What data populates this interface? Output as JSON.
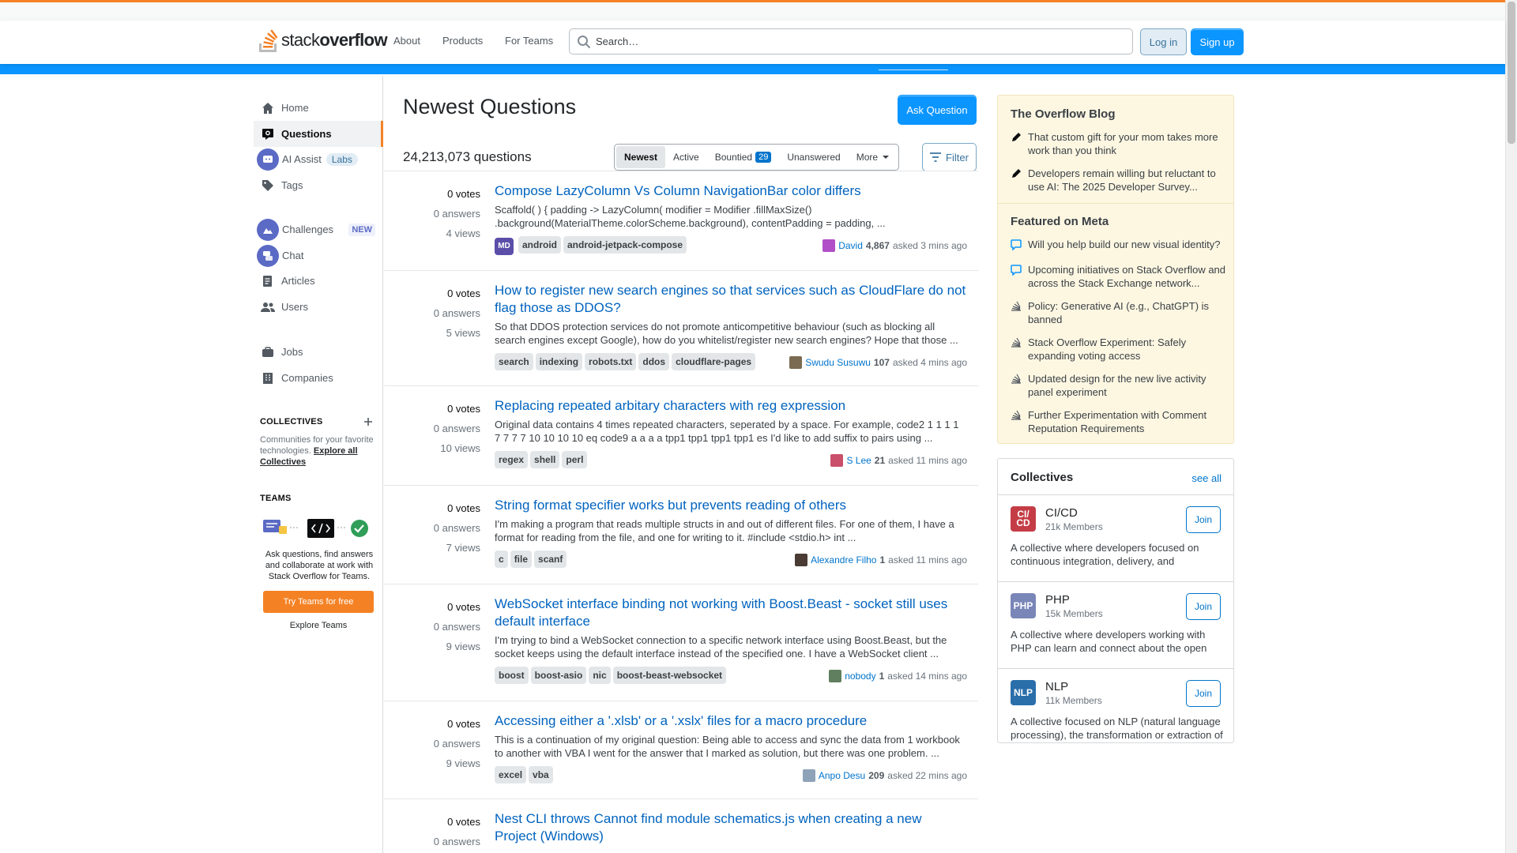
{
  "header": {
    "logo_text_light": "stack",
    "logo_text_bold": "overflow",
    "nav": [
      "About",
      "Products",
      "For Teams"
    ],
    "search_placeholder": "Search…",
    "login_label": "Log in",
    "signup_label": "Sign up"
  },
  "sidebar": {
    "items": [
      {
        "label": "Home",
        "icon": "home-icon"
      },
      {
        "label": "Questions",
        "icon": "questions-icon"
      },
      {
        "label": "AI Assist",
        "icon": "ai-assist-icon",
        "badge": "Labs"
      },
      {
        "label": "Tags",
        "icon": "tag-icon"
      },
      {
        "label": "Challenges",
        "icon": "challenges-icon",
        "badge": "NEW"
      },
      {
        "label": "Chat",
        "icon": "chat-icon"
      },
      {
        "label": "Articles",
        "icon": "articles-icon"
      },
      {
        "label": "Users",
        "icon": "users-icon"
      },
      {
        "label": "Jobs",
        "icon": "jobs-icon"
      },
      {
        "label": "Companies",
        "icon": "companies-icon"
      }
    ],
    "collectives_heading": "COLLECTIVES",
    "collectives_text": "Communities for your favorite technologies.",
    "collectives_link": "Explore all Collectives",
    "teams_heading": "TEAMS",
    "teams_text": "Ask questions, find answers and collaborate at work with Stack Overflow for Teams.",
    "teams_button": "Try Teams for free",
    "teams_explore": "Explore Teams"
  },
  "main": {
    "title": "Newest Questions",
    "ask_button": "Ask Question",
    "question_count": "24,213,073 questions",
    "filters": [
      {
        "label": "Newest",
        "active": true
      },
      {
        "label": "Active"
      },
      {
        "label": "Bountied",
        "count": "29"
      },
      {
        "label": "Unanswered"
      },
      {
        "label": "More"
      }
    ],
    "filter_button": "Filter",
    "questions": [
      {
        "votes": "0 votes",
        "answers": "0 answers",
        "views": "4 views",
        "title": "Compose LazyColumn Vs Column NavigationBar color differs",
        "excerpt": "Scaffold( ) { padding -> LazyColumn( modifier = Modifier .fillMaxSize() .background(MaterialTheme.colorScheme.background), contentPadding = padding, ...",
        "collective_tag": "MD",
        "tags": [
          "android",
          "android-jetpack-compose"
        ],
        "user": "David",
        "rep": "4,867",
        "asked": "asked 3 mins ago",
        "avatar_color": "#b04fc7"
      },
      {
        "votes": "0 votes",
        "answers": "0 answers",
        "views": "5 views",
        "title": "How to register new search engines so that services such as CloudFlare do not flag those as DDOS?",
        "excerpt": "So that DDOS protection services do not promote anticompetitive behaviour (such as blocking all search engines except Google), how do you whitelist/register new search engines? Hope that those ...",
        "tags": [
          "search",
          "indexing",
          "robots.txt",
          "ddos",
          "cloudflare-pages"
        ],
        "user": "Swudu Susuwu",
        "rep": "107",
        "asked": "asked 4 mins ago",
        "avatar_color": "#7a6b52"
      },
      {
        "votes": "0 votes",
        "answers": "0 answers",
        "views": "10 views",
        "title": "Replacing repeated arbitary characters with reg expression",
        "excerpt": "Original data contains 4 times repeated characters, seperated by a space. For example, code2 1 1 1 1 7 7 7 7 10 10 10 10 eq code9 a a a a tpp1 tpp1 tpp1 tpp1 es I'd like to add suffix to pairs using ...",
        "tags": [
          "regex",
          "shell",
          "perl"
        ],
        "user": "S Lee",
        "rep": "21",
        "asked": "asked 11 mins ago",
        "avatar_color": "#c94f6a"
      },
      {
        "votes": "0 votes",
        "answers": "0 answers",
        "views": "7 views",
        "title": "String format specifier works but prevents reading of others",
        "excerpt": "I'm making a program that reads multiple structs in and out of different files. For one of them, I have a format for reading from the file, and one for writing to it. #include <stdio.h> int ...",
        "tags": [
          "c",
          "file",
          "scanf"
        ],
        "user": "Alexandre Filho",
        "rep": "1",
        "asked": "asked 11 mins ago",
        "avatar_color": "#4a3b34"
      },
      {
        "votes": "0 votes",
        "answers": "0 answers",
        "views": "9 views",
        "title": "WebSocket interface binding not working with Boost.Beast - socket still uses default interface",
        "excerpt": "I'm trying to bind a WebSocket connection to a specific network interface using Boost.Beast, but the socket keeps using the default interface instead of the specified one. I have a WebSocket client ...",
        "tags": [
          "boost",
          "boost-asio",
          "nic",
          "boost-beast-websocket"
        ],
        "user": "nobody",
        "rep": "1",
        "asked": "asked 14 mins ago",
        "avatar_color": "#5f7f5f"
      },
      {
        "votes": "0 votes",
        "answers": "0 answers",
        "views": "9 views",
        "title": "Accessing either a '.xlsb' or a '.xslx' files for a macro procedure",
        "excerpt": "This is a continuation of my original question: Being able to access and sync the data from 1 workbook to another with VBA I went for the answer that I marked as solution, but there was one problem. ...",
        "tags": [
          "excel",
          "vba"
        ],
        "user": "Anpo Desu",
        "rep": "209",
        "asked": "asked 22 mins ago",
        "avatar_color": "#8fa3b8"
      },
      {
        "votes": "0 votes",
        "answers": "0 answers",
        "views": "",
        "title": "Nest CLI throws Cannot find module schematics.js when creating a new Project (Windows)",
        "excerpt": "",
        "tags": [],
        "user": "",
        "rep": "",
        "asked": "",
        "avatar_color": "#999999"
      }
    ]
  },
  "right": {
    "blog_heading": "The Overflow Blog",
    "blog_items": [
      "That custom gift for your mom takes more work than you think",
      "Developers remain willing but reluctant to use AI: The 2025 Developer Survey..."
    ],
    "meta_heading": "Featured on Meta",
    "meta_items": [
      {
        "text": "Will you help build our new visual identity?",
        "icon": "chat-bubble-icon"
      },
      {
        "text": "Upcoming initiatives on Stack Overflow and across the Stack Exchange network...",
        "icon": "chat-bubble-icon"
      },
      {
        "text": "Policy: Generative AI (e.g., ChatGPT) is banned",
        "icon": "stack-exchange-icon"
      },
      {
        "text": "Stack Overflow Experiment: Safely expanding voting access",
        "icon": "stack-exchange-icon"
      },
      {
        "text": "Updated design for the new live activity panel experiment",
        "icon": "stack-exchange-icon"
      },
      {
        "text": "Further Experimentation with Comment Reputation Requirements",
        "icon": "stack-exchange-icon"
      }
    ],
    "collectives_title": "Collectives",
    "collectives_see_all": "see all",
    "collectives": [
      {
        "logo": "CI/ CD",
        "name": "CI/CD",
        "members": "21k Members",
        "desc": "A collective where developers focused on continuous integration, delivery, and deployment can find, share, and learn",
        "color": "#c43d46",
        "join": "Join"
      },
      {
        "logo": "PHP",
        "name": "PHP",
        "members": "15k Members",
        "desc": "A collective where developers working with PHP can learn and connect about the open source scripting language.",
        "color": "#7a86b8",
        "join": "Join"
      },
      {
        "logo": "NLP",
        "name": "NLP",
        "members": "11k Members",
        "desc": "A collective focused on NLP (natural language processing), the transformation or extraction of useful information",
        "color": "#2a6eaa",
        "join": "Join"
      }
    ]
  }
}
